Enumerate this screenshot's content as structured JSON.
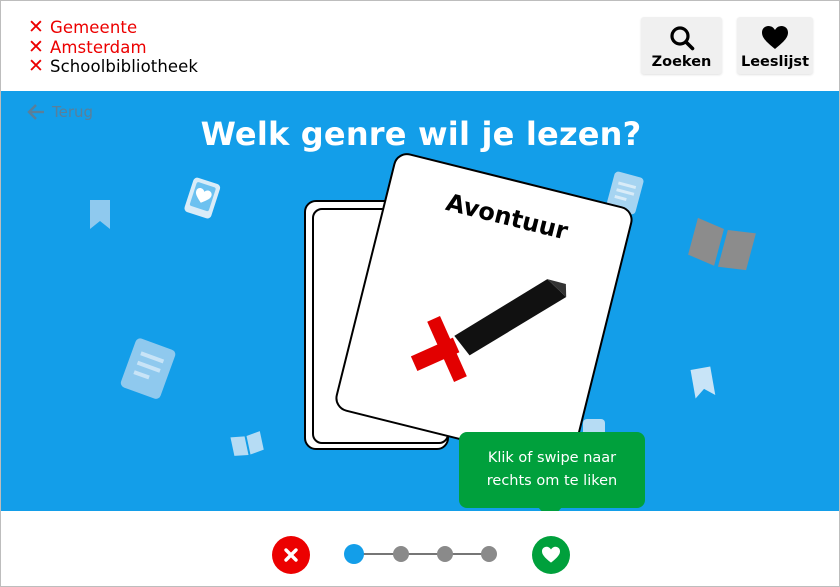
{
  "header": {
    "logo": {
      "line1": "Gemeente",
      "line2": "Amsterdam",
      "line3": "Schoolbibliotheek",
      "mark": "✕"
    },
    "search_label": "Zoeken",
    "list_label": "Leeslijst",
    "icons": {
      "search": "search-icon",
      "list": "heart-icon"
    }
  },
  "main": {
    "back_label": "Terug",
    "question": "Welk genre wil je lezen?",
    "card": {
      "title": "Avontuur",
      "icon": "sword-icon"
    },
    "tooltip": "Klik of swipe naar rechts om te liken"
  },
  "controls": {
    "dislike_icon": "close-icon",
    "like_icon": "heart-icon",
    "progress": {
      "total": 4,
      "current": 1
    }
  },
  "colors": {
    "brand_red": "#ec0000",
    "stage_blue": "#139ee9",
    "like_green": "#00a03c"
  }
}
